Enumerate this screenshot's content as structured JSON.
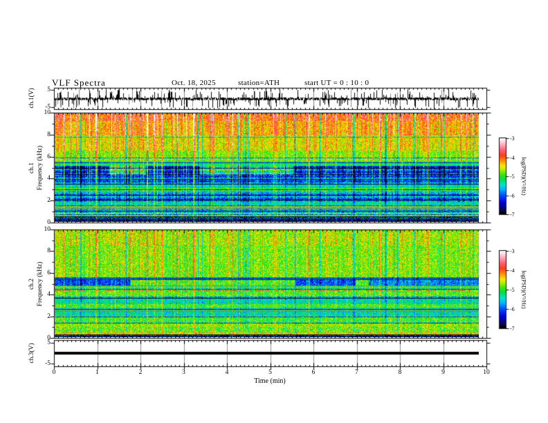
{
  "title": {
    "main": "VLF  Spectra",
    "date": "Oct. 18, 2025",
    "station": "station=ATH",
    "start_ut": "start UT  =   0 : 10 : 0"
  },
  "axes": {
    "time": {
      "label": "Time  (min)",
      "ticks": [
        "0",
        "1",
        "2",
        "3",
        "4",
        "5",
        "6",
        "7",
        "8",
        "9",
        "10"
      ],
      "range_min": [
        0,
        10
      ],
      "minor_step_min": 0.1
    },
    "wave_volts": {
      "ticks": [
        "5",
        "-5"
      ],
      "range_V": [
        -6.25,
        6.25
      ]
    },
    "freq_khz": {
      "ticks": [
        "10",
        "8",
        "6",
        "4",
        "2",
        "0"
      ],
      "range_kHz": [
        0,
        10
      ]
    }
  },
  "panels": [
    {
      "id": "wave1",
      "ylabel": "ch.1(V)"
    },
    {
      "id": "spec1",
      "ylabel_ch": "ch.1",
      "ylabel": "Frequency  (kHz)"
    },
    {
      "id": "spec2",
      "ylabel_ch": "ch.2",
      "ylabel": "Frequency  (kHz)"
    },
    {
      "id": "wave3",
      "ylabel": "ch.3(V)"
    }
  ],
  "colorbar": {
    "label": "log(PSD)(V²/Hz)",
    "ticks": [
      "-3",
      "-4",
      "-5",
      "-6",
      "-7"
    ],
    "range": [
      -7,
      -3
    ],
    "stops": [
      {
        "v": -7.0,
        "c": "#000000"
      },
      {
        "v": -6.8,
        "c": "#0a0a50"
      },
      {
        "v": -6.4,
        "c": "#0000dc"
      },
      {
        "v": -6.0,
        "c": "#0050ff"
      },
      {
        "v": -5.7,
        "c": "#00b4ff"
      },
      {
        "v": -5.45,
        "c": "#00e6c8"
      },
      {
        "v": -5.15,
        "c": "#00dc50"
      },
      {
        "v": -4.9,
        "c": "#46e600"
      },
      {
        "v": -4.6,
        "c": "#c8f000"
      },
      {
        "v": -4.45,
        "c": "#ffe600"
      },
      {
        "v": -4.2,
        "c": "#ff9600"
      },
      {
        "v": -3.9,
        "c": "#ff3c1e"
      },
      {
        "v": -3.6,
        "c": "#ff6478"
      },
      {
        "v": -3.3,
        "c": "#ffb4c8"
      },
      {
        "v": -3.0,
        "c": "#ffffff"
      }
    ]
  },
  "chart_data": [
    {
      "id": "wave1",
      "type": "line",
      "title": "ch.1(V) broadband waveform",
      "x_range_min": [
        0,
        9.8
      ],
      "y_range_V": [
        -5,
        5
      ],
      "mean_V": 0,
      "noise_amplitude_V": 0.9,
      "spike_rate": 0.1,
      "spike_amplitude_V": 4.5,
      "gray_spike_rate": 0.06
    },
    {
      "id": "spec1",
      "type": "heatmap",
      "title": "ch.1 VLF spectrogram",
      "x_range_min": [
        0,
        9.8
      ],
      "freq_range_kHz": [
        0,
        10
      ],
      "psd_log_range": [
        -7,
        -3
      ],
      "bands": [
        {
          "f0": 9.3,
          "f1": 10.0,
          "base": -4.25,
          "noise": 0.45,
          "streak": 1.2
        },
        {
          "f0": 8.0,
          "f1": 9.3,
          "base": -4.5,
          "noise": 0.4,
          "streak": 1.1
        },
        {
          "f0": 6.6,
          "f1": 8.0,
          "base": -4.7,
          "noise": 0.38,
          "streak": 0.95
        },
        {
          "f0": 5.6,
          "f1": 6.6,
          "base": -4.95,
          "noise": 0.35,
          "streak": 0.8
        },
        {
          "f0": 5.15,
          "f1": 5.6,
          "base": -5.3,
          "noise": 0.35,
          "streak": 0.6
        },
        {
          "f0": 4.25,
          "f1": 5.15,
          "base": -6.45,
          "noise": 0.5,
          "streak": 1.35,
          "rowvar": 0.3
        },
        {
          "f0": 3.45,
          "f1": 4.25,
          "base": -6.15,
          "noise": 0.5,
          "streak": 1.0,
          "rowvar": 0.35
        },
        {
          "f0": 3.1,
          "f1": 3.45,
          "base": -5.6,
          "noise": 0.4,
          "streak": 0.6
        },
        {
          "f0": 2.8,
          "f1": 3.1,
          "base": -5.1,
          "noise": 0.35,
          "streak": 0.4
        },
        {
          "f0": 2.25,
          "f1": 2.8,
          "base": -5.95,
          "noise": 0.5,
          "streak": 0.8,
          "rowvar": 0.3
        },
        {
          "f0": 1.8,
          "f1": 2.25,
          "base": -6.15,
          "noise": 0.5,
          "streak": 0.8,
          "rowvar": 0.3
        },
        {
          "f0": 1.5,
          "f1": 1.8,
          "base": -5.55,
          "noise": 0.4,
          "streak": 0.5
        },
        {
          "f0": 1.2,
          "f1": 1.5,
          "base": -4.95,
          "noise": 0.35,
          "streak": 0.3
        },
        {
          "f0": 0.8,
          "f1": 1.2,
          "base": -5.75,
          "noise": 0.55,
          "streak": 0.6
        },
        {
          "f0": 0.5,
          "f1": 0.8,
          "base": -5.05,
          "noise": 0.7,
          "streak": 0.4
        },
        {
          "f0": 0.25,
          "f1": 0.5,
          "base": -6.2,
          "noise": 0.8,
          "streak": 0.5,
          "banded": true
        },
        {
          "f0": 0.0,
          "f1": 0.25,
          "base": -6.7,
          "noise": 0.6,
          "streak": 0.3,
          "banded": true
        }
      ],
      "dark_lines_kHz": [
        7.8,
        5.9,
        5.45,
        4.92,
        4.38,
        3.9,
        3.44,
        2.95,
        2.46,
        1.97,
        1.48,
        0.99,
        0.66
      ],
      "gray_lines_kHz": [
        1.32,
        1.24
      ],
      "patches": [
        {
          "f0": 4.3,
          "f1": 5.15,
          "dv": 1.0,
          "segs_min": [
            [
              1.25,
              2.1
            ],
            [
              3.35,
              5.5
            ]
          ]
        }
      ]
    },
    {
      "id": "spec2",
      "type": "heatmap",
      "title": "ch.2 VLF spectrogram",
      "x_range_min": [
        0,
        9.8
      ],
      "freq_range_kHz": [
        0,
        10
      ],
      "psd_log_range": [
        -7,
        -3
      ],
      "neg_streaks": true,
      "bands": [
        {
          "f0": 8.6,
          "f1": 10.0,
          "base": -4.85,
          "noise": 0.42,
          "streak": 0.75
        },
        {
          "f0": 5.6,
          "f1": 8.6,
          "base": -4.95,
          "noise": 0.4,
          "streak": 0.65
        },
        {
          "f0": 5.35,
          "f1": 5.6,
          "base": -5.7,
          "noise": 0.45,
          "streak": 0.5
        },
        {
          "f0": 4.8,
          "f1": 5.35,
          "base": -5.05,
          "noise": 0.45,
          "streak": 0.55,
          "segs": [
            [
              0,
              1.75,
              -1.2
            ],
            [
              5.55,
              6.95,
              -1.15
            ],
            [
              7.25,
              9.8,
              -0.9
            ]
          ]
        },
        {
          "f0": 4.4,
          "f1": 4.8,
          "base": -5.2,
          "noise": 0.45,
          "streak": 0.5
        },
        {
          "f0": 3.8,
          "f1": 4.4,
          "base": -5.0,
          "noise": 0.4,
          "streak": 0.45
        },
        {
          "f0": 3.6,
          "f1": 3.8,
          "base": -5.85,
          "noise": 0.45,
          "streak": 0.4
        },
        {
          "f0": 3.1,
          "f1": 3.6,
          "base": -5.5,
          "noise": 0.45,
          "streak": 0.45
        },
        {
          "f0": 2.75,
          "f1": 3.1,
          "base": -5.05,
          "noise": 0.4,
          "streak": 0.4
        },
        {
          "f0": 2.35,
          "f1": 2.75,
          "base": -5.35,
          "noise": 0.45,
          "streak": 0.4
        },
        {
          "f0": 1.95,
          "f1": 2.35,
          "base": -5.5,
          "noise": 0.45,
          "streak": 0.4
        },
        {
          "f0": 1.25,
          "f1": 1.95,
          "base": -5.1,
          "noise": 0.45,
          "streak": 0.4
        },
        {
          "f0": 0.95,
          "f1": 1.25,
          "base": -4.8,
          "noise": 0.45,
          "streak": 0.3
        },
        {
          "f0": 0.4,
          "f1": 0.95,
          "base": -4.95,
          "noise": 0.5,
          "streak": 0.35
        },
        {
          "f0": 0.2,
          "f1": 0.4,
          "base": -4.55,
          "noise": 0.6,
          "streak": 0.3
        },
        {
          "f0": 0.0,
          "f1": 0.2,
          "base": -6.5,
          "noise": 0.7,
          "streak": 0.3,
          "banded": true
        }
      ],
      "dark_lines_kHz": [
        5.55,
        5.38,
        4.45,
        3.62,
        2.62,
        1.9,
        1.28
      ],
      "gray_lines_kHz": [
        4.78,
        2.52,
        2.4
      ],
      "red_dash_lines": [
        {
          "f_kHz": 4.36,
          "psd_log": -3.85
        },
        {
          "f_kHz": 0.3,
          "psd_log": -4.3
        }
      ]
    },
    {
      "id": "wave3",
      "type": "line",
      "title": "ch.3(V) flat signal",
      "x_range_min": [
        0,
        9.8
      ],
      "y_range_V": [
        -5,
        5
      ],
      "value_V": 0,
      "flat": true
    }
  ]
}
